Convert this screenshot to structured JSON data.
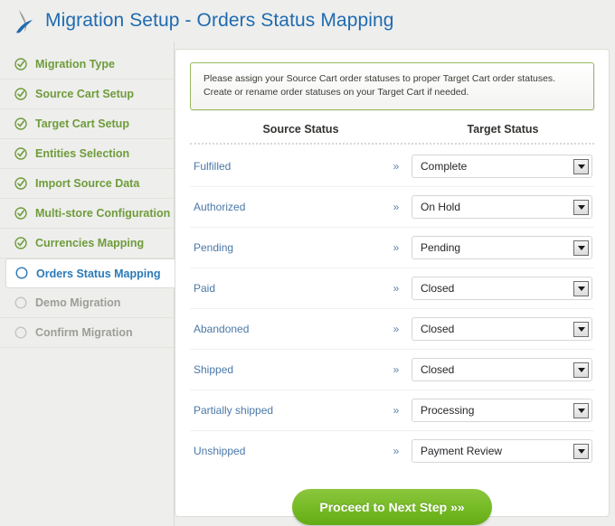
{
  "header": {
    "title": "Migration Setup - Orders Status Mapping",
    "logo_icon": "swoosh-logo-icon",
    "title_color": "#1f6bb0"
  },
  "sidebar": {
    "items": [
      {
        "label": "Migration Type",
        "state": "done",
        "icon": "check-circle-icon"
      },
      {
        "label": "Source Cart Setup",
        "state": "done",
        "icon": "check-circle-icon"
      },
      {
        "label": "Target Cart Setup",
        "state": "done",
        "icon": "check-circle-icon"
      },
      {
        "label": "Entities Selection",
        "state": "done",
        "icon": "check-circle-icon"
      },
      {
        "label": "Import Source Data",
        "state": "done",
        "icon": "check-circle-icon"
      },
      {
        "label": "Multi-store Configuration",
        "state": "done",
        "icon": "check-circle-icon"
      },
      {
        "label": "Currencies Mapping",
        "state": "done",
        "icon": "check-circle-icon"
      },
      {
        "label": "Orders Status Mapping",
        "state": "active",
        "icon": "empty-circle-icon"
      },
      {
        "label": "Demo Migration",
        "state": "pending",
        "icon": "empty-circle-icon"
      },
      {
        "label": "Confirm Migration",
        "state": "pending",
        "icon": "empty-circle-icon"
      }
    ],
    "colors": {
      "done": "#6f9c3b",
      "active": "#2b7ab8",
      "pending": "#9d9d98"
    }
  },
  "info_box": {
    "line1": "Please assign your Source Cart order statuses to proper Target Cart order statuses.",
    "line2": "Create or rename order statuses on your Target Cart if needed.",
    "border_color": "#96b95c"
  },
  "table": {
    "headers": {
      "source": "Source Status",
      "target": "Target Status"
    },
    "arrow_glyph": "»",
    "rows": [
      {
        "source": "Fulfilled",
        "target": "Complete"
      },
      {
        "source": "Authorized",
        "target": "On Hold"
      },
      {
        "source": "Pending",
        "target": "Pending"
      },
      {
        "source": "Paid",
        "target": "Closed"
      },
      {
        "source": "Abandoned",
        "target": "Closed"
      },
      {
        "source": "Shipped",
        "target": "Closed"
      },
      {
        "source": "Partially shipped",
        "target": "Processing"
      },
      {
        "source": "Unshipped",
        "target": "Payment Review"
      }
    ]
  },
  "footer": {
    "proceed_label": "Proceed to Next Step »»",
    "proceed_color": "#76bb26"
  }
}
